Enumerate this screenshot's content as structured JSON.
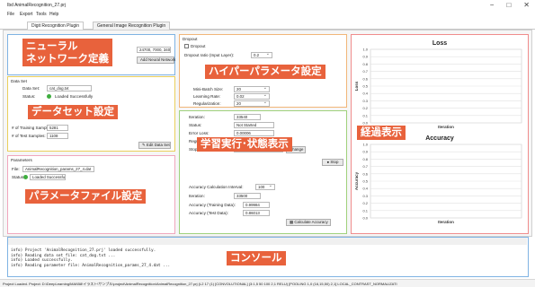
{
  "window": {
    "title": "Ibd AnimalRecognition_27.prj",
    "controls": [
      "−",
      "□",
      "✕"
    ]
  },
  "menu": [
    "File",
    "Export",
    "Tools",
    "Help"
  ],
  "tabs": [
    "Digit Recognition Plugin",
    "General Image Recognition Plugin"
  ],
  "network": {
    "overlay": "ニューラル\nネットワーク定義",
    "layers_value": "24700, 7000, 3400)",
    "add_button": "Add Neural Network"
  },
  "dataset": {
    "title": "Data Set",
    "file_label": "Data Set:",
    "file_value": "cat_dog.txt",
    "status_label": "Status:",
    "status_value": "Loaded Successfully",
    "overlay": "データセット設定",
    "training_label": "# of Training Samples:",
    "training_value": "5281",
    "test_label": "# of Test Samples:",
    "test_value": "1108",
    "edit_button": "Edit Data Set"
  },
  "parameters": {
    "title": "Parameters",
    "file_label": "File:",
    "file_value": "AnimalRecognition_params_27_4.dat",
    "status_label": "Status:",
    "status_value": "Loaded Successfully",
    "overlay": "パラメータファイル設定"
  },
  "hyper": {
    "title": "Dropout",
    "dropout_check": "Dropout",
    "ratio_label": "Dropout ratio (Input Layer):",
    "ratio_value": "0.2",
    "overlay": "ハイパーパラメータ設定",
    "batch_label": "Mini-Batch Size:",
    "batch_value": "20",
    "lr_label": "Learning Rate:",
    "lr_value": "0.02",
    "reg_label": "Regularization:",
    "reg_value": "20"
  },
  "training": {
    "iteration_label": "Iteration:",
    "iteration_value": "33540",
    "status_label": "Status:",
    "status_value": "Not Started",
    "error_label": "Error Loss:",
    "error_value": "0.00006",
    "regloss_label": "Regularization Loss:",
    "regloss_value": "0.01470",
    "stop_label": "Stop Condition:",
    "stop_value": "Max Iterations 50000",
    "change_button": "Change",
    "stop_button": "Stop",
    "overlay": "学習実行･状態表示",
    "acc_interval_label": "Accuracy Calculation Interval:",
    "acc_interval_value": "100",
    "acc_iter_label": "Iteration:",
    "acc_iter_value": "33500",
    "acc_train_label": "Accuracy (Training Data):",
    "acc_train_value": "0.99984",
    "acc_test_label": "Accuracy (Test Data):",
    "acc_test_value": "0.86013",
    "calc_button": "Calculate Accuracy"
  },
  "progress_overlay": "経過表示",
  "chart_data": [
    {
      "type": "line",
      "title": "Loss",
      "xlabel": "Iteration",
      "ylabel": "Loss",
      "yticks": [
        "1.0",
        "0.9",
        "0.8",
        "0.7",
        "0.6",
        "0.5",
        "0.4",
        "0.3",
        "0.2",
        "0.1",
        "0.0"
      ],
      "ylim": [
        0,
        1.0
      ],
      "grid": true,
      "series": []
    },
    {
      "type": "line",
      "title": "Accuracy",
      "xlabel": "Iteration",
      "ylabel": "Accuracy",
      "yticks": [
        "1.0",
        "0.9",
        "0.8",
        "0.7",
        "0.6",
        "0.5",
        "0.4",
        "0.3",
        "0.2",
        "0.1",
        "0.0"
      ],
      "ylim": [
        0,
        1.0
      ],
      "grid": true,
      "series": []
    }
  ],
  "console": {
    "overlay": "コンソール",
    "lines": [
      "info) Project 'AnimalRecognition_27.prj' loaded successfully.",
      "info) Reading data set file: cat_dog.txt ...",
      "info) Loaded successfully.",
      "info) Reading parameter file: AnimalRecognition_params_27_4.dat ..."
    ]
  },
  "statusbar": {
    "text": "Project Loaded. Project: D:\\DeepLearning\\MAI\\B8\\イラスト\\サンプル\\project\\AnimalRecognition\\AnimalRecognition_27.prj (L2 17 (1) [CONVOLUTIONAL] (3:1,5 50 100 2,1 RELU) [POOLING 1,0 (16,15,50) 2,1] LOCAL_CONTRAST_NORMALIZATI"
  },
  "colors": {
    "overlay": "#e8623c",
    "network_border": "#7fb3e3",
    "dataset_border": "#e9cf5c",
    "params_border": "#f0a6bd",
    "hyper_border": "#f1b679",
    "training_border": "#9fd17b",
    "progress_border": "#f08c8c"
  }
}
